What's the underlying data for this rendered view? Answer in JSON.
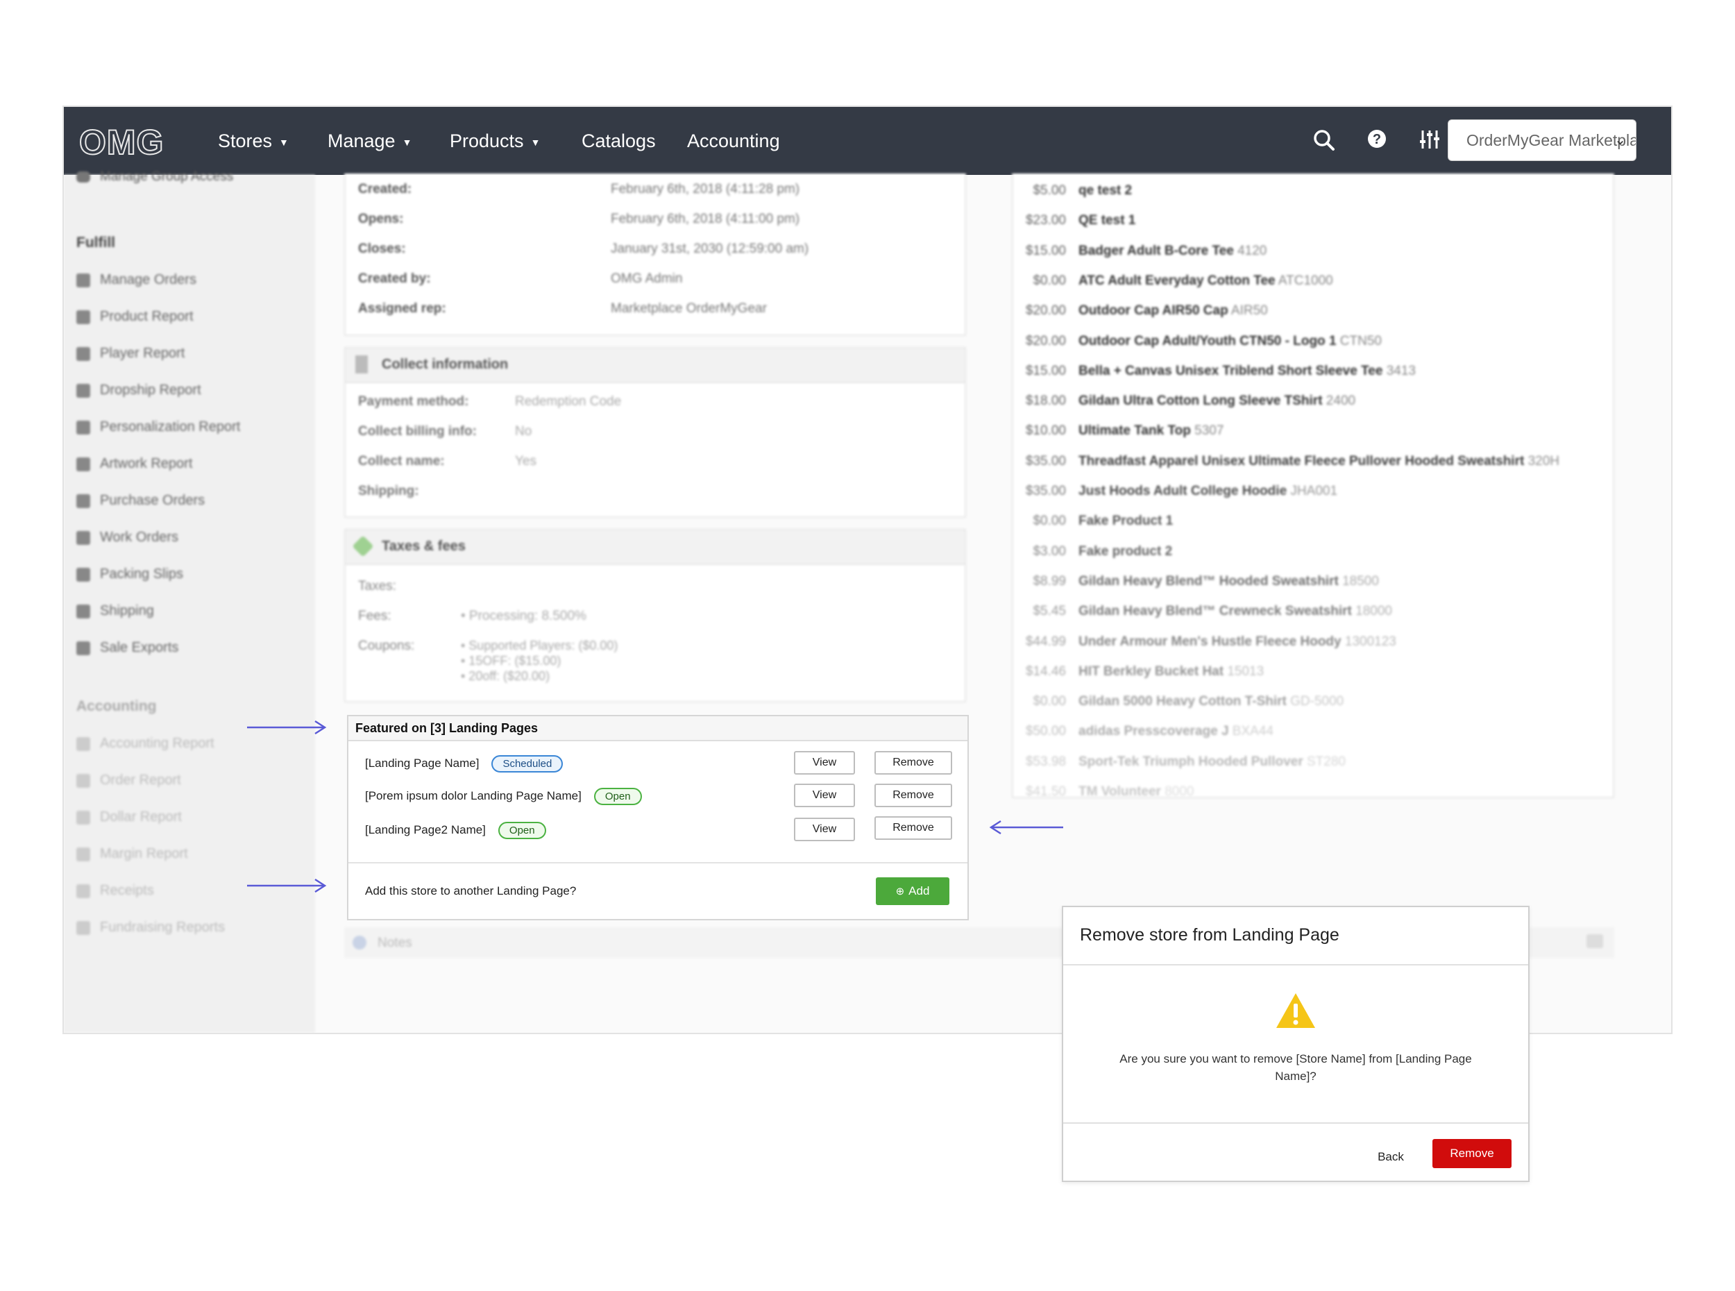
{
  "nav": {
    "logo": "OMG",
    "items": [
      {
        "label": "Stores",
        "dropdown": true
      },
      {
        "label": "Manage",
        "dropdown": true
      },
      {
        "label": "Products",
        "dropdown": true
      },
      {
        "label": "Catalogs",
        "dropdown": false
      },
      {
        "label": "Accounting",
        "dropdown": false
      }
    ],
    "store_select": "OrderMyGear Marketpla"
  },
  "sidebar": {
    "top_item": "Manage Group Access",
    "fulfill_heading": "Fulfill",
    "fulfill_items": [
      "Manage Orders",
      "Product Report",
      "Player Report",
      "Dropship Report",
      "Personalization Report",
      "Artwork Report",
      "Purchase Orders",
      "Work Orders",
      "Packing Slips",
      "Shipping",
      "Sale Exports"
    ],
    "accounting_heading": "Accounting",
    "accounting_items": [
      "Accounting Report",
      "Order Report",
      "Dollar Report",
      "Margin Report",
      "Receipts",
      "Fundraising Reports"
    ]
  },
  "details": {
    "rows": [
      {
        "k": "Created:",
        "v": "February 6th, 2018 (4:11:28 pm)"
      },
      {
        "k": "Opens:",
        "v": "February 6th, 2018 (4:11:00 pm)"
      },
      {
        "k": "Closes:",
        "v": "January 31st, 2030 (12:59:00 am)"
      },
      {
        "k": "Created by:",
        "v": "OMG Admin"
      },
      {
        "k": "Assigned rep:",
        "v": "Marketplace OrderMyGear"
      }
    ]
  },
  "collect": {
    "title": "Collect information",
    "rows": [
      {
        "k": "Payment method:",
        "v": "Redemption Code"
      },
      {
        "k": "Collect billing info:",
        "v": "No"
      },
      {
        "k": "Collect name:",
        "v": "Yes"
      },
      {
        "k": "Shipping:",
        "v": ""
      }
    ]
  },
  "taxes": {
    "title": "Taxes & fees",
    "taxes_label": "Taxes:",
    "fees_label": "Fees:",
    "fees_value": "• Processing: 8.500%",
    "coupons_label": "Coupons:",
    "coupons": [
      "• Supported Players: ($0.00)",
      "• 15OFF: ($15.00)",
      "• 20off: ($20.00)"
    ]
  },
  "notes_label": "Notes",
  "products": [
    {
      "price": "$5.00",
      "name": "qe test 2",
      "sku": ""
    },
    {
      "price": "$23.00",
      "name": "QE test 1",
      "sku": ""
    },
    {
      "price": "$15.00",
      "name": "Badger Adult B-Core Tee",
      "sku": "4120"
    },
    {
      "price": "$0.00",
      "name": "ATC Adult Everyday Cotton Tee",
      "sku": "ATC1000"
    },
    {
      "price": "$20.00",
      "name": "Outdoor Cap AIR50 Cap",
      "sku": "AIR50"
    },
    {
      "price": "$20.00",
      "name": "Outdoor Cap Adult/Youth CTN50 - Logo 1",
      "sku": "CTN50"
    },
    {
      "price": "$15.00",
      "name": "Bella + Canvas Unisex Triblend Short Sleeve Tee",
      "sku": "3413"
    },
    {
      "price": "$18.00",
      "name": "Gildan Ultra Cotton Long Sleeve TShirt",
      "sku": "2400"
    },
    {
      "price": "$10.00",
      "name": "Ultimate Tank Top",
      "sku": "5307"
    },
    {
      "price": "$35.00",
      "name": "Threadfast Apparel Unisex Ultimate Fleece Pullover Hooded Sweatshirt",
      "sku": "320H"
    },
    {
      "price": "$35.00",
      "name": "Just Hoods Adult College Hoodie",
      "sku": "JHA001"
    },
    {
      "price": "$0.00",
      "name": "Fake Product 1",
      "sku": ""
    },
    {
      "price": "$3.00",
      "name": "Fake product 2",
      "sku": ""
    },
    {
      "price": "$8.99",
      "name": "Gildan Heavy Blend™ Hooded Sweatshirt",
      "sku": "18500"
    },
    {
      "price": "$5.45",
      "name": "Gildan Heavy Blend™ Crewneck Sweatshirt",
      "sku": "18000"
    },
    {
      "price": "$44.99",
      "name": "Under Armour Men's Hustle Fleece Hoody",
      "sku": "1300123"
    },
    {
      "price": "$14.46",
      "name": "HIT Berkley Bucket Hat",
      "sku": "15013"
    },
    {
      "price": "$0.00",
      "name": "Gildan 5000 Heavy Cotton T-Shirt",
      "sku": "GD-5000"
    },
    {
      "price": "$50.00",
      "name": "adidas Presscoverage J",
      "sku": "BXA44"
    },
    {
      "price": "$53.98",
      "name": "Sport-Tek Triumph Hooded Pullover",
      "sku": "ST280"
    },
    {
      "price": "$41.50",
      "name": "TM Volunteer",
      "sku": "8000"
    }
  ],
  "featured": {
    "title": "Featured on [3] Landing Pages",
    "rows": [
      {
        "name": "[Landing Page Name]",
        "status": "Scheduled"
      },
      {
        "name": "[Porem ipsum dolor Landing Page Name]",
        "status": "Open"
      },
      {
        "name": "[Landing Page2 Name]",
        "status": "Open"
      }
    ],
    "view_label": "View",
    "remove_label": "Remove",
    "add_prompt": "Add this store to another Landing Page?",
    "add_label": "Add"
  },
  "modal": {
    "title": "Remove store from Landing Page",
    "message": "Are you sure you want to remove [Store Name] from [Landing Page Name]?",
    "back_label": "Back",
    "remove_label": "Remove"
  },
  "colors": {
    "nav_bg": "#343a45",
    "add_green": "#4ca93b",
    "danger_red": "#d10c0c",
    "arrow_blue": "#5a5ad6",
    "warning_yellow": "#f5c518"
  }
}
